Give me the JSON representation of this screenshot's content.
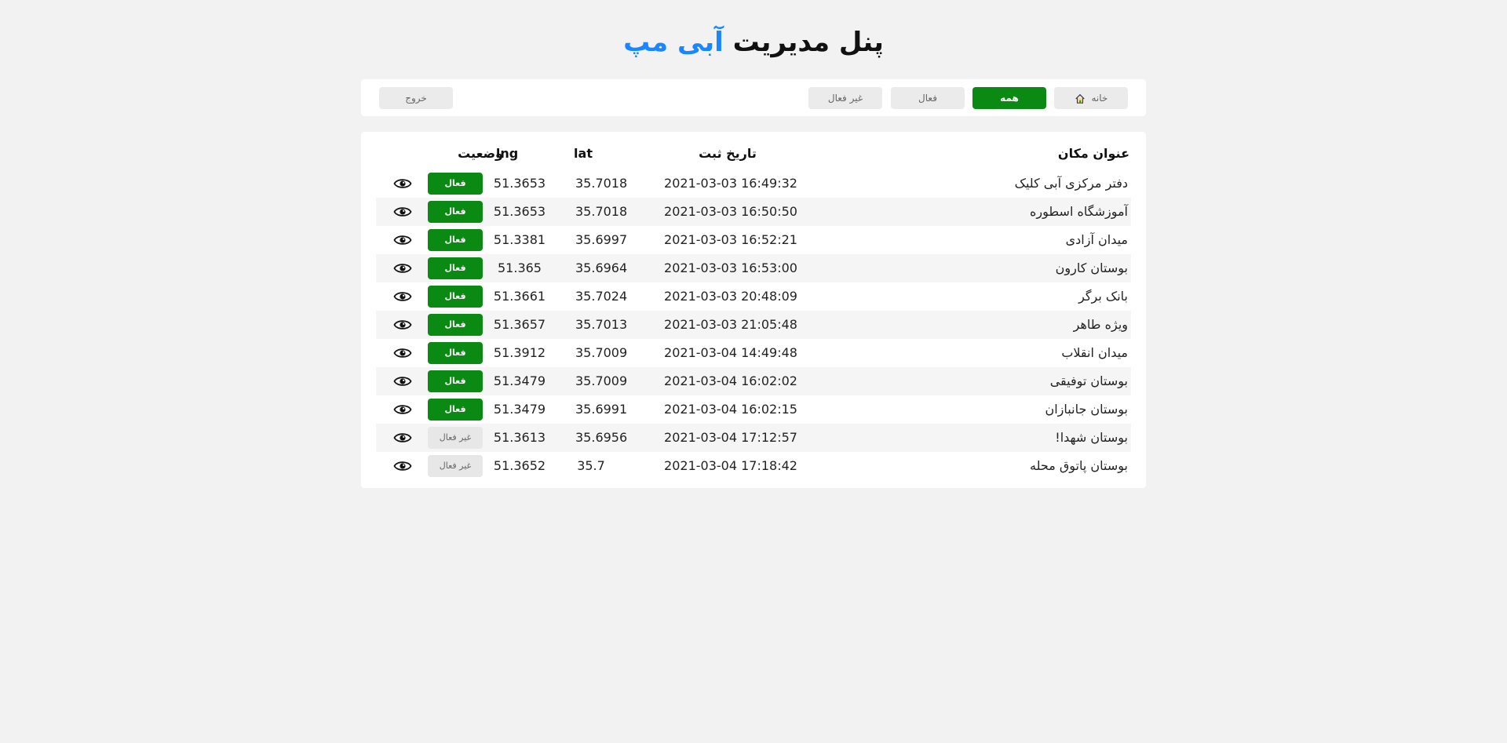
{
  "header": {
    "title_prefix": "پنل مدیریت",
    "brand": "آبی مپ"
  },
  "toolbar": {
    "home_label": "خانه",
    "all_label": "همه",
    "active_label": "فعال",
    "inactive_label": "غیر فعال",
    "logout_label": "خروج",
    "home_icon": "home-icon",
    "accent_color": "#0a8a12"
  },
  "table": {
    "headers": {
      "title": "عنوان مکان",
      "date": "تاریخ ثبت",
      "lat": "lat",
      "lng": "lng",
      "status": "وضعیت"
    },
    "rows": [
      {
        "title": "دفتر مرکزی آبی کلیک",
        "date": "2021-03-03 16:49:32",
        "lat": "35.7018",
        "lng": "51.3653",
        "status": "فعال",
        "active": true
      },
      {
        "title": "آموزشگاه اسطوره",
        "date": "2021-03-03 16:50:50",
        "lat": "35.7018",
        "lng": "51.3653",
        "status": "فعال",
        "active": true
      },
      {
        "title": "میدان آزادی",
        "date": "2021-03-03 16:52:21",
        "lat": "35.6997",
        "lng": "51.3381",
        "status": "فعال",
        "active": true
      },
      {
        "title": "بوستان کارون",
        "date": "2021-03-03 16:53:00",
        "lat": "35.6964",
        "lng": "51.365",
        "status": "فعال",
        "active": true
      },
      {
        "title": "بانک برگر",
        "date": "2021-03-03 20:48:09",
        "lat": "35.7024",
        "lng": "51.3661",
        "status": "فعال",
        "active": true
      },
      {
        "title": "ویژه طاهر",
        "date": "2021-03-03 21:05:48",
        "lat": "35.7013",
        "lng": "51.3657",
        "status": "فعال",
        "active": true
      },
      {
        "title": "میدان انقلاب",
        "date": "2021-03-04 14:49:48",
        "lat": "35.7009",
        "lng": "51.3912",
        "status": "فعال",
        "active": true
      },
      {
        "title": "بوستان توفیقی",
        "date": "2021-03-04 16:02:02",
        "lat": "35.7009",
        "lng": "51.3479",
        "status": "فعال",
        "active": true
      },
      {
        "title": "بوستان جانبازان",
        "date": "2021-03-04 16:02:15",
        "lat": "35.6991",
        "lng": "51.3479",
        "status": "فعال",
        "active": true
      },
      {
        "title": "بوستان شهدا!",
        "date": "2021-03-04 17:12:57",
        "lat": "35.6956",
        "lng": "51.3613",
        "status": "غیر فعال",
        "active": false
      },
      {
        "title": "بوستان پاتوق محله",
        "date": "2021-03-04 17:18:42",
        "lat": "35.7",
        "lng": "51.3652",
        "status": "غیر فعال",
        "active": false
      }
    ],
    "view_icon": "eye-icon"
  }
}
